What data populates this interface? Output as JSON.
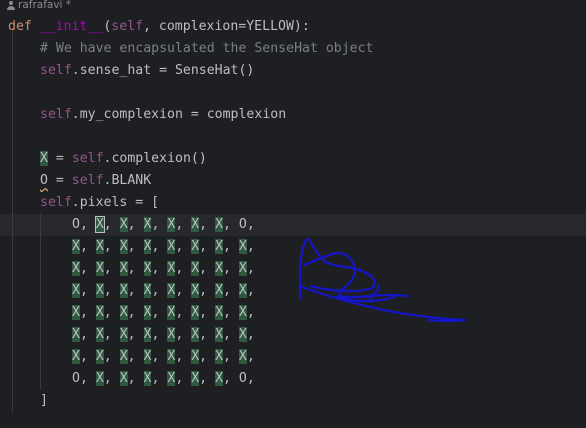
{
  "author": {
    "name": "rafrafavi *",
    "icon": "person-icon"
  },
  "code": {
    "line1": {
      "kw": "def",
      "fn": "__init__",
      "open": "(",
      "self": "self",
      "rest": ", complexion=YELLOW):"
    },
    "line2": "# We have encapsulated the SenseHat object",
    "line3": {
      "self": "self",
      "rest": ".sense_hat = SenseHat()"
    },
    "line4": {
      "self": "self",
      "rest": ".my_complexion = complexion"
    },
    "line5": {
      "var": "X",
      "eq": " = ",
      "self": "self",
      "rest": ".complexion()"
    },
    "line6": {
      "var": "O",
      "eq": " = ",
      "self": "self",
      "rest": ".BLANK"
    },
    "line7": {
      "self": "self",
      "rest": ".pixels = ["
    },
    "pixel_rows": [
      [
        "O",
        "X",
        "X",
        "X",
        "X",
        "X",
        "X",
        "O"
      ],
      [
        "X",
        "X",
        "X",
        "X",
        "X",
        "X",
        "X",
        "X"
      ],
      [
        "X",
        "X",
        "X",
        "X",
        "X",
        "X",
        "X",
        "X"
      ],
      [
        "X",
        "X",
        "X",
        "X",
        "X",
        "X",
        "X",
        "X"
      ],
      [
        "X",
        "X",
        "X",
        "X",
        "X",
        "X",
        "X",
        "X"
      ],
      [
        "X",
        "X",
        "X",
        "X",
        "X",
        "X",
        "X",
        "X"
      ],
      [
        "X",
        "X",
        "X",
        "X",
        "X",
        "X",
        "X",
        "X"
      ],
      [
        "O",
        "X",
        "X",
        "X",
        "X",
        "X",
        "X",
        "O"
      ]
    ],
    "close": "]"
  },
  "annotation": {
    "ink_color": "#1414c8",
    "kind": "handwritten scribble"
  }
}
